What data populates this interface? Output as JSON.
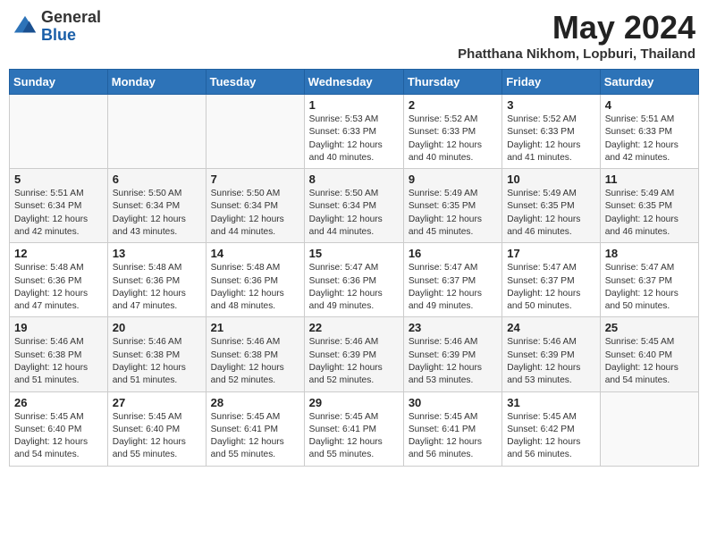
{
  "header": {
    "logo_general": "General",
    "logo_blue": "Blue",
    "month_year": "May 2024",
    "location": "Phatthana Nikhom, Lopburi, Thailand"
  },
  "days_of_week": [
    "Sunday",
    "Monday",
    "Tuesday",
    "Wednesday",
    "Thursday",
    "Friday",
    "Saturday"
  ],
  "weeks": [
    [
      {
        "day": "",
        "info": ""
      },
      {
        "day": "",
        "info": ""
      },
      {
        "day": "",
        "info": ""
      },
      {
        "day": "1",
        "info": "Sunrise: 5:53 AM\nSunset: 6:33 PM\nDaylight: 12 hours and 40 minutes."
      },
      {
        "day": "2",
        "info": "Sunrise: 5:52 AM\nSunset: 6:33 PM\nDaylight: 12 hours and 40 minutes."
      },
      {
        "day": "3",
        "info": "Sunrise: 5:52 AM\nSunset: 6:33 PM\nDaylight: 12 hours and 41 minutes."
      },
      {
        "day": "4",
        "info": "Sunrise: 5:51 AM\nSunset: 6:33 PM\nDaylight: 12 hours and 42 minutes."
      }
    ],
    [
      {
        "day": "5",
        "info": "Sunrise: 5:51 AM\nSunset: 6:34 PM\nDaylight: 12 hours and 42 minutes."
      },
      {
        "day": "6",
        "info": "Sunrise: 5:50 AM\nSunset: 6:34 PM\nDaylight: 12 hours and 43 minutes."
      },
      {
        "day": "7",
        "info": "Sunrise: 5:50 AM\nSunset: 6:34 PM\nDaylight: 12 hours and 44 minutes."
      },
      {
        "day": "8",
        "info": "Sunrise: 5:50 AM\nSunset: 6:34 PM\nDaylight: 12 hours and 44 minutes."
      },
      {
        "day": "9",
        "info": "Sunrise: 5:49 AM\nSunset: 6:35 PM\nDaylight: 12 hours and 45 minutes."
      },
      {
        "day": "10",
        "info": "Sunrise: 5:49 AM\nSunset: 6:35 PM\nDaylight: 12 hours and 46 minutes."
      },
      {
        "day": "11",
        "info": "Sunrise: 5:49 AM\nSunset: 6:35 PM\nDaylight: 12 hours and 46 minutes."
      }
    ],
    [
      {
        "day": "12",
        "info": "Sunrise: 5:48 AM\nSunset: 6:36 PM\nDaylight: 12 hours and 47 minutes."
      },
      {
        "day": "13",
        "info": "Sunrise: 5:48 AM\nSunset: 6:36 PM\nDaylight: 12 hours and 47 minutes."
      },
      {
        "day": "14",
        "info": "Sunrise: 5:48 AM\nSunset: 6:36 PM\nDaylight: 12 hours and 48 minutes."
      },
      {
        "day": "15",
        "info": "Sunrise: 5:47 AM\nSunset: 6:36 PM\nDaylight: 12 hours and 49 minutes."
      },
      {
        "day": "16",
        "info": "Sunrise: 5:47 AM\nSunset: 6:37 PM\nDaylight: 12 hours and 49 minutes."
      },
      {
        "day": "17",
        "info": "Sunrise: 5:47 AM\nSunset: 6:37 PM\nDaylight: 12 hours and 50 minutes."
      },
      {
        "day": "18",
        "info": "Sunrise: 5:47 AM\nSunset: 6:37 PM\nDaylight: 12 hours and 50 minutes."
      }
    ],
    [
      {
        "day": "19",
        "info": "Sunrise: 5:46 AM\nSunset: 6:38 PM\nDaylight: 12 hours and 51 minutes."
      },
      {
        "day": "20",
        "info": "Sunrise: 5:46 AM\nSunset: 6:38 PM\nDaylight: 12 hours and 51 minutes."
      },
      {
        "day": "21",
        "info": "Sunrise: 5:46 AM\nSunset: 6:38 PM\nDaylight: 12 hours and 52 minutes."
      },
      {
        "day": "22",
        "info": "Sunrise: 5:46 AM\nSunset: 6:39 PM\nDaylight: 12 hours and 52 minutes."
      },
      {
        "day": "23",
        "info": "Sunrise: 5:46 AM\nSunset: 6:39 PM\nDaylight: 12 hours and 53 minutes."
      },
      {
        "day": "24",
        "info": "Sunrise: 5:46 AM\nSunset: 6:39 PM\nDaylight: 12 hours and 53 minutes."
      },
      {
        "day": "25",
        "info": "Sunrise: 5:45 AM\nSunset: 6:40 PM\nDaylight: 12 hours and 54 minutes."
      }
    ],
    [
      {
        "day": "26",
        "info": "Sunrise: 5:45 AM\nSunset: 6:40 PM\nDaylight: 12 hours and 54 minutes."
      },
      {
        "day": "27",
        "info": "Sunrise: 5:45 AM\nSunset: 6:40 PM\nDaylight: 12 hours and 55 minutes."
      },
      {
        "day": "28",
        "info": "Sunrise: 5:45 AM\nSunset: 6:41 PM\nDaylight: 12 hours and 55 minutes."
      },
      {
        "day": "29",
        "info": "Sunrise: 5:45 AM\nSunset: 6:41 PM\nDaylight: 12 hours and 55 minutes."
      },
      {
        "day": "30",
        "info": "Sunrise: 5:45 AM\nSunset: 6:41 PM\nDaylight: 12 hours and 56 minutes."
      },
      {
        "day": "31",
        "info": "Sunrise: 5:45 AM\nSunset: 6:42 PM\nDaylight: 12 hours and 56 minutes."
      },
      {
        "day": "",
        "info": ""
      }
    ]
  ]
}
